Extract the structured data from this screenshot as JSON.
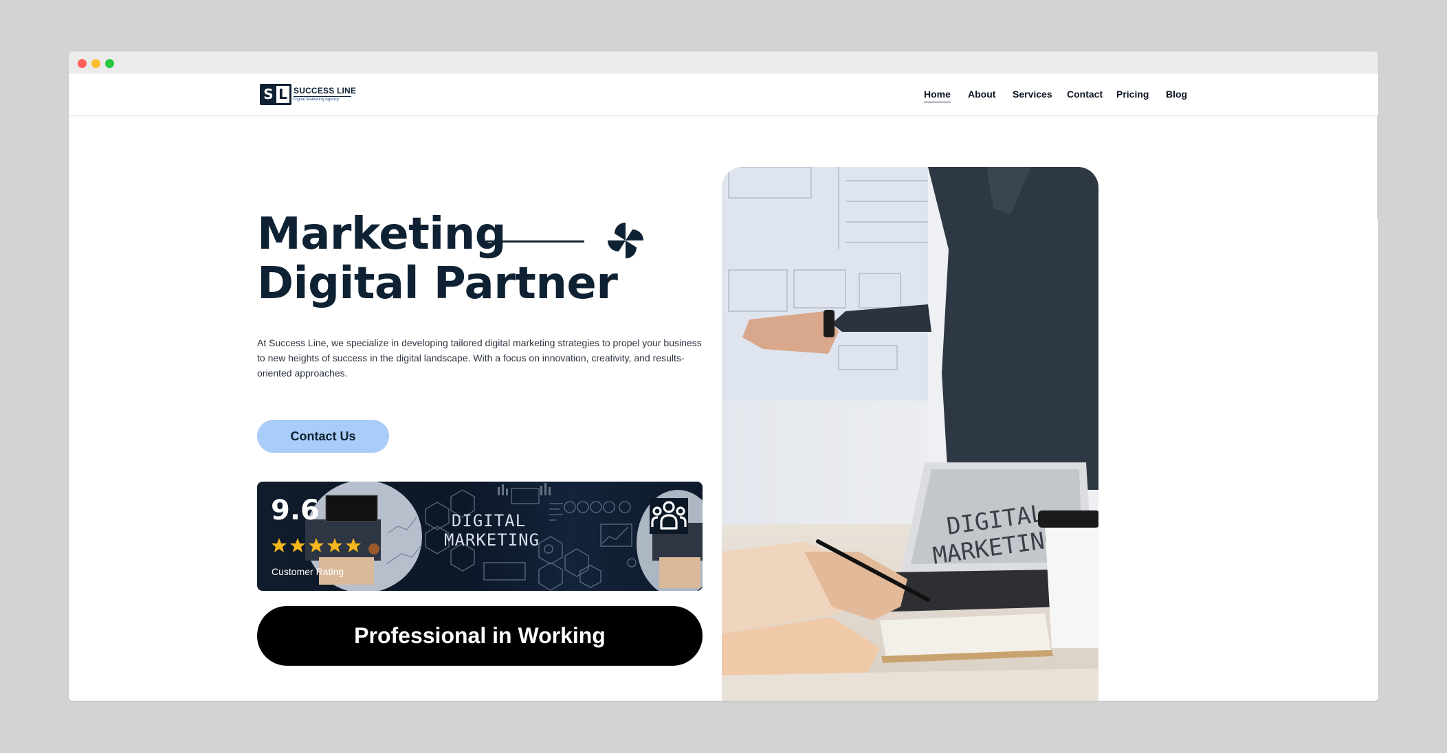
{
  "logo": {
    "mark_left": "S",
    "mark_right": "L",
    "name": "SUCCESS LINE",
    "tagline": "Digital Marketing Agency"
  },
  "nav": {
    "items": [
      {
        "label": "Home",
        "active": true
      },
      {
        "label": "About"
      },
      {
        "label": "Services"
      },
      {
        "label": "Contact"
      },
      {
        "label": "Pricing"
      },
      {
        "label": "Blog"
      }
    ]
  },
  "hero": {
    "title_line1": "Marketing",
    "title_line2": "Digital Partner",
    "description": "At Success Line, we specialize in developing tailored digital marketing strategies to propel your business to new heights of success in the digital landscape. With a focus on innovation, creativity, and results-oriented approaches.",
    "cta_label": "Contact Us"
  },
  "rating": {
    "value": "9.6",
    "stars": 5,
    "label": "Customer Rating",
    "banner_text_line1": "DIGITAL",
    "banner_text_line2": "MARKETING"
  },
  "badge": {
    "label": "Professional in Working"
  },
  "photo": {
    "laptop_text_line1": "DIGITAL",
    "laptop_text_line2": "MARKETING"
  },
  "colors": {
    "navy": "#0f2233",
    "cta_bg": "#a9ccf9",
    "star": "#f5b81c",
    "pill_bg": "#000000"
  },
  "icons": [
    "pinwheel-icon",
    "star-icon",
    "team-icon"
  ]
}
